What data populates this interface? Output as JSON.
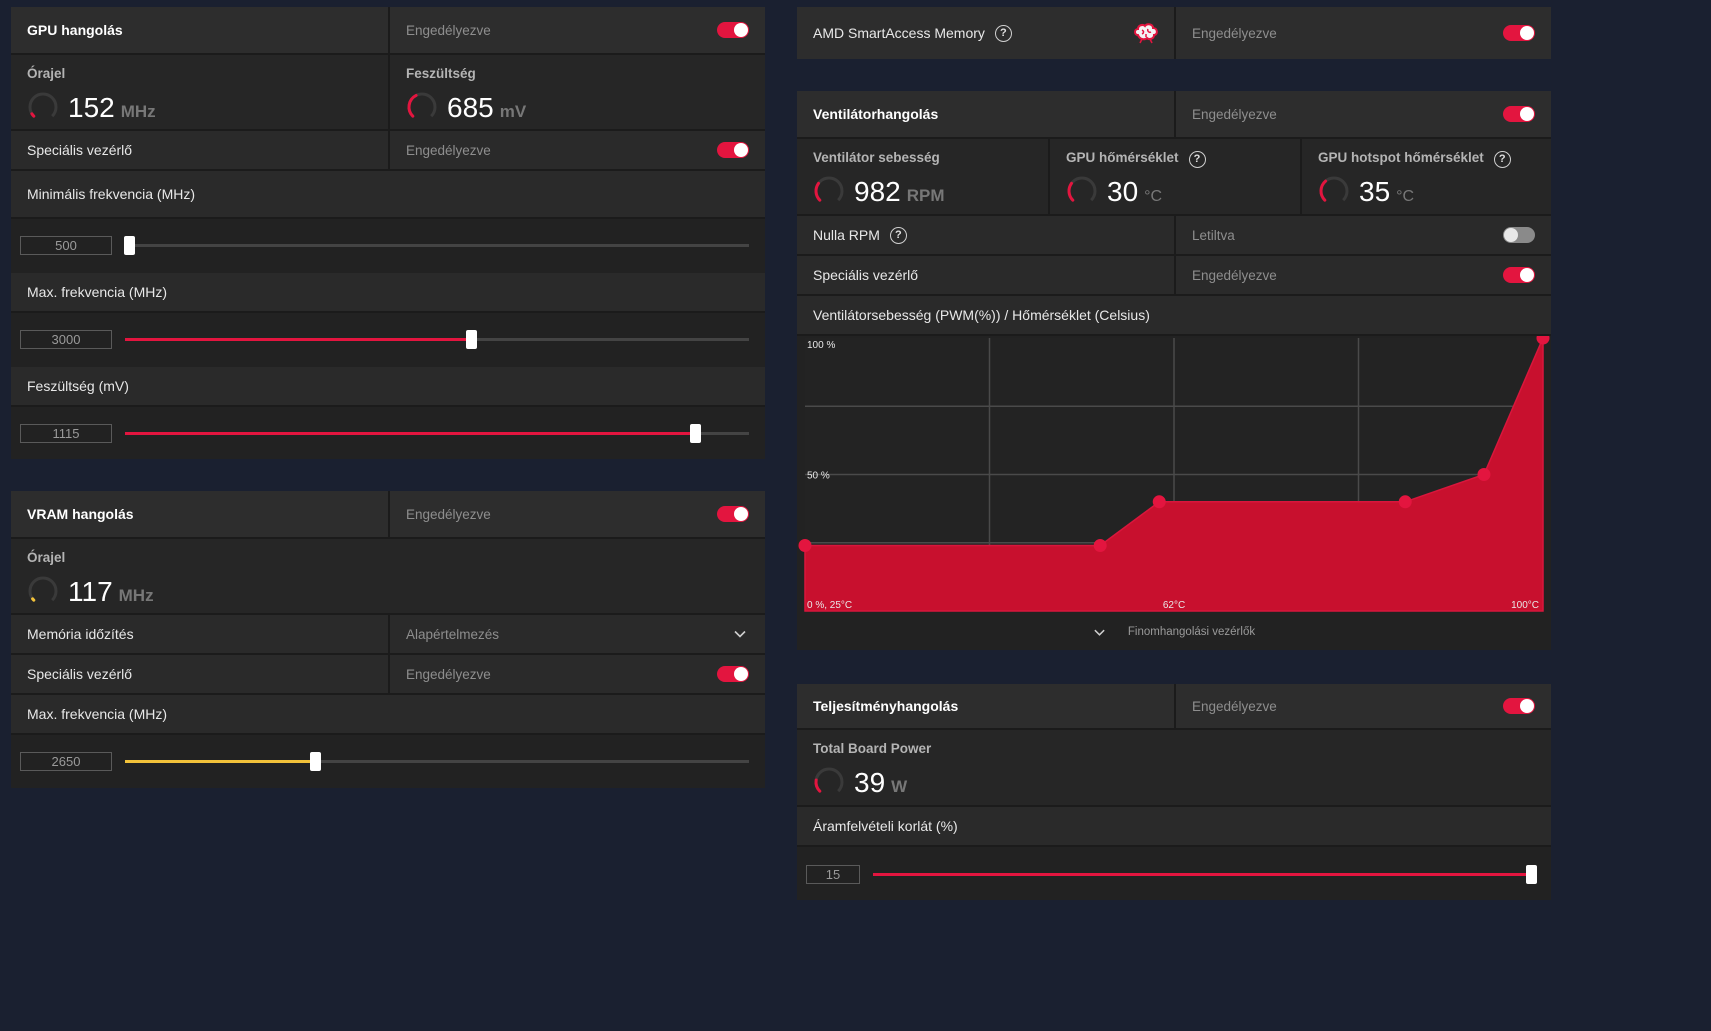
{
  "gpu": {
    "title": "GPU hangolás",
    "status": "Engedélyezve",
    "clock": {
      "label": "Órajel",
      "value": "152",
      "unit": "MHz",
      "level": 0.05
    },
    "voltage": {
      "label": "Feszültség",
      "value": "685",
      "unit": "mV",
      "level": 0.4
    },
    "special": {
      "label": "Speciális vezérlő",
      "status": "Engedélyezve"
    },
    "min_freq": {
      "label": "Minimális frekvencia (MHz)",
      "value": "500",
      "position": 0.0
    },
    "max_freq": {
      "label": "Max. frekvencia (MHz)",
      "value": "3000",
      "position": 0.555
    },
    "volt_slider": {
      "label": "Feszültség (mV)",
      "value": "1115",
      "position": 0.913
    }
  },
  "vram": {
    "title": "VRAM hangolás",
    "status": "Engedélyezve",
    "clock": {
      "label": "Órajel",
      "value": "117",
      "unit": "MHz",
      "level": 0.03
    },
    "timing": {
      "label": "Memória időzítés",
      "value": "Alapértelmezés"
    },
    "special": {
      "label": "Speciális vezérlő",
      "status": "Engedélyezve"
    },
    "max_freq": {
      "label": "Max. frekvencia (MHz)",
      "value": "2650",
      "position": 0.305
    }
  },
  "sam": {
    "title": "AMD SmartAccess Memory",
    "status": "Engedélyezve"
  },
  "fan": {
    "title": "Ventilátorhangolás",
    "status": "Engedélyezve",
    "speed": {
      "label": "Ventilátor sebesség",
      "value": "982",
      "unit": "RPM",
      "level": 0.3
    },
    "gpu_temp": {
      "label": "GPU hőmérséklet",
      "value": "30",
      "unit": "°C",
      "level": 0.3
    },
    "hotspot": {
      "label": "GPU hotspot hőmérséklet",
      "value": "35",
      "unit": "°C",
      "level": 0.35
    },
    "zero_rpm": {
      "label": "Nulla RPM",
      "status": "Letiltva"
    },
    "special": {
      "label": "Speciális vezérlő",
      "status": "Engedélyezve"
    },
    "curve_title": "Ventilátorsebesség (PWM(%)) / Hőmérséklet (Celsius)",
    "fine_tune": "Finomhangolási vezérlők"
  },
  "perf": {
    "title": "Teljesítményhangolás",
    "status": "Engedélyezve",
    "power": {
      "label": "Total Board Power",
      "value": "39",
      "unit": "W",
      "level": 0.2
    },
    "limit": {
      "label": "Áramfelvételi korlát (%)",
      "value": "15",
      "position": 1.0
    }
  },
  "chart_data": {
    "type": "area",
    "title": "Ventilátorsebesség (PWM(%)) / Hőmérséklet (Celsius)",
    "y_tick_labels": [
      "100 %",
      "50 %"
    ],
    "x_tick_labels": [
      "0 %, 25°C",
      "62°C",
      "100°C"
    ],
    "xlim": [
      25,
      100
    ],
    "ylim": [
      0,
      100
    ],
    "series": [
      {
        "x": [
          25,
          55,
          61,
          86,
          94,
          100
        ],
        "y": [
          24,
          24,
          40,
          40,
          50,
          100
        ]
      }
    ],
    "accent": "#c8102e",
    "point_color": "#e3153f"
  },
  "colors": {
    "accent": "#e3153f",
    "vram_accent": "#f2c23a"
  }
}
